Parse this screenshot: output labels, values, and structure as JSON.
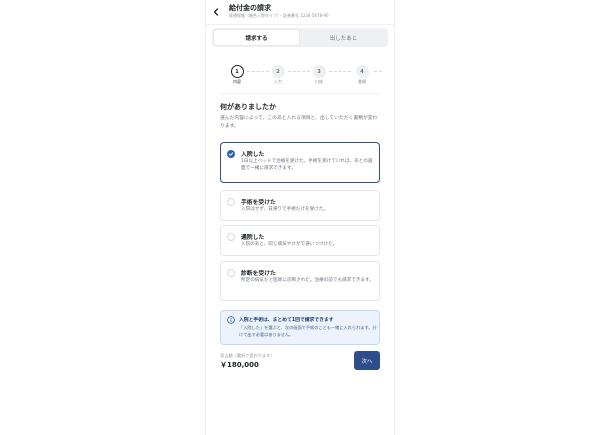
{
  "header": {
    "title": "給付金の請求",
    "subtitle": "医療保険（総合入院タイプ）・証券番号 1234-5678-90"
  },
  "tabs": [
    {
      "label": "請求する",
      "active": true
    },
    {
      "label": "出したあと",
      "active": false
    }
  ],
  "steps": [
    {
      "number": "1",
      "label": "内容",
      "active": true
    },
    {
      "number": "2",
      "label": "入力",
      "active": false
    },
    {
      "number": "3",
      "label": "口座",
      "active": false
    },
    {
      "number": "4",
      "label": "書類",
      "active": false
    }
  ],
  "question": {
    "title": "何がありましたか",
    "description": "選んだ内容によって、このあと入れる項目と、出していただく書類が変わります。"
  },
  "options": [
    {
      "title": "入院した",
      "description": "1日以上ベッドで治療を受けた。手術を受けていれば、あとの画面で一緒に請求できます。",
      "selected": true
    },
    {
      "title": "手術を受けた",
      "description": "入院はせず、日帰りで手術だけを受けた。",
      "selected": false
    },
    {
      "title": "通院した",
      "description": "入院のあと、同じ病気やけがで通いつづけた。",
      "selected": false
    },
    {
      "title": "診断を受けた",
      "description": "所定の病気だと医師に診断された。治療の前でも請求できます。",
      "selected": false
    }
  ],
  "notice": {
    "title": "入院と手術は、まとめて1回で請求できます",
    "text": "「入院した」を選ぶと、次の画面で手術のことも一緒に入れられます。分けて出す必要はありません。"
  },
  "footer": {
    "total_label": "見込額（選択で変わります）",
    "total_value": "￥180,000",
    "next_label": "次へ"
  },
  "colors": {
    "accent": "#2e4d8a",
    "radio_checked": "#2f5fb3",
    "notice_bg": "#edf3fc"
  },
  "icons": {
    "back": "chevron-left-icon",
    "check": "check-icon",
    "info": "info-icon"
  }
}
